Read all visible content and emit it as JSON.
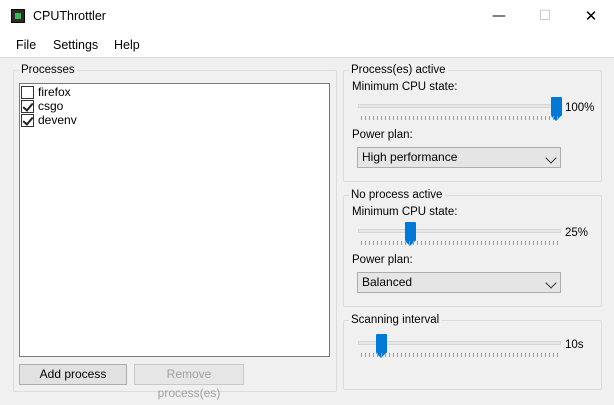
{
  "window": {
    "title": "CPUThrottler",
    "minimize_glyph": "—",
    "maximize_glyph": "☐",
    "close_glyph": "✕"
  },
  "menu": [
    "File",
    "Settings",
    "Help"
  ],
  "processes": {
    "title": "Processes",
    "items": [
      {
        "name": "firefox",
        "checked": false
      },
      {
        "name": "csgo",
        "checked": true
      },
      {
        "name": "devenv",
        "checked": true
      }
    ],
    "add_label": "Add process",
    "remove_label": "Remove process(es)"
  },
  "active": {
    "title": "Process(es) active",
    "min_cpu_label": "Minimum CPU state:",
    "min_cpu_percent": 100,
    "min_cpu_value": "100%",
    "power_plan_label": "Power plan:",
    "power_plan": "High performance"
  },
  "inactive": {
    "title": "No process active",
    "min_cpu_label": "Minimum CPU state:",
    "min_cpu_percent": 25,
    "min_cpu_value": "25%",
    "power_plan_label": "Power plan:",
    "power_plan": "Balanced"
  },
  "scanning": {
    "title": "Scanning interval",
    "value": "10s",
    "slider_fraction": 0.1
  },
  "colors": {
    "accent": "#0078d7",
    "client_bg": "#f0f0f0"
  },
  "icons": {
    "app": "cpu-chip-icon",
    "minimize": "minimize-icon",
    "maximize": "maximize-icon",
    "close": "close-icon",
    "combo": "chevron-down-icon"
  }
}
